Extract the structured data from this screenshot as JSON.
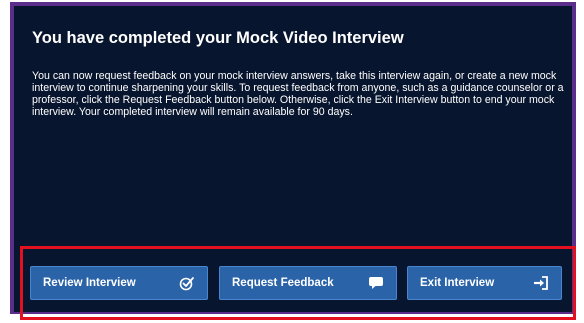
{
  "dialog": {
    "title": "You have completed your Mock Video Interview",
    "message": "You can now request feedback on your mock interview answers, take this interview again, or create a new mock interview to continue sharpening your skills. To request feedback from anyone, such as a guidance counselor or a professor, click the Request Feedback button below. Otherwise, click the Exit Interview button to end your mock interview. Your completed interview will remain available for 90 days."
  },
  "actions": {
    "review_label": "Review Interview",
    "review_icon": "check-circle-icon",
    "feedback_label": "Request Feedback",
    "feedback_icon": "speech-bubble-icon",
    "exit_label": "Exit Interview",
    "exit_icon": "exit-arrow-icon"
  },
  "colors": {
    "panel_background": "#08152e",
    "frame_border": "#5a2e8a",
    "button_background": "#2a63a8",
    "highlight_border": "#e3101f",
    "text": "#ffffff"
  }
}
